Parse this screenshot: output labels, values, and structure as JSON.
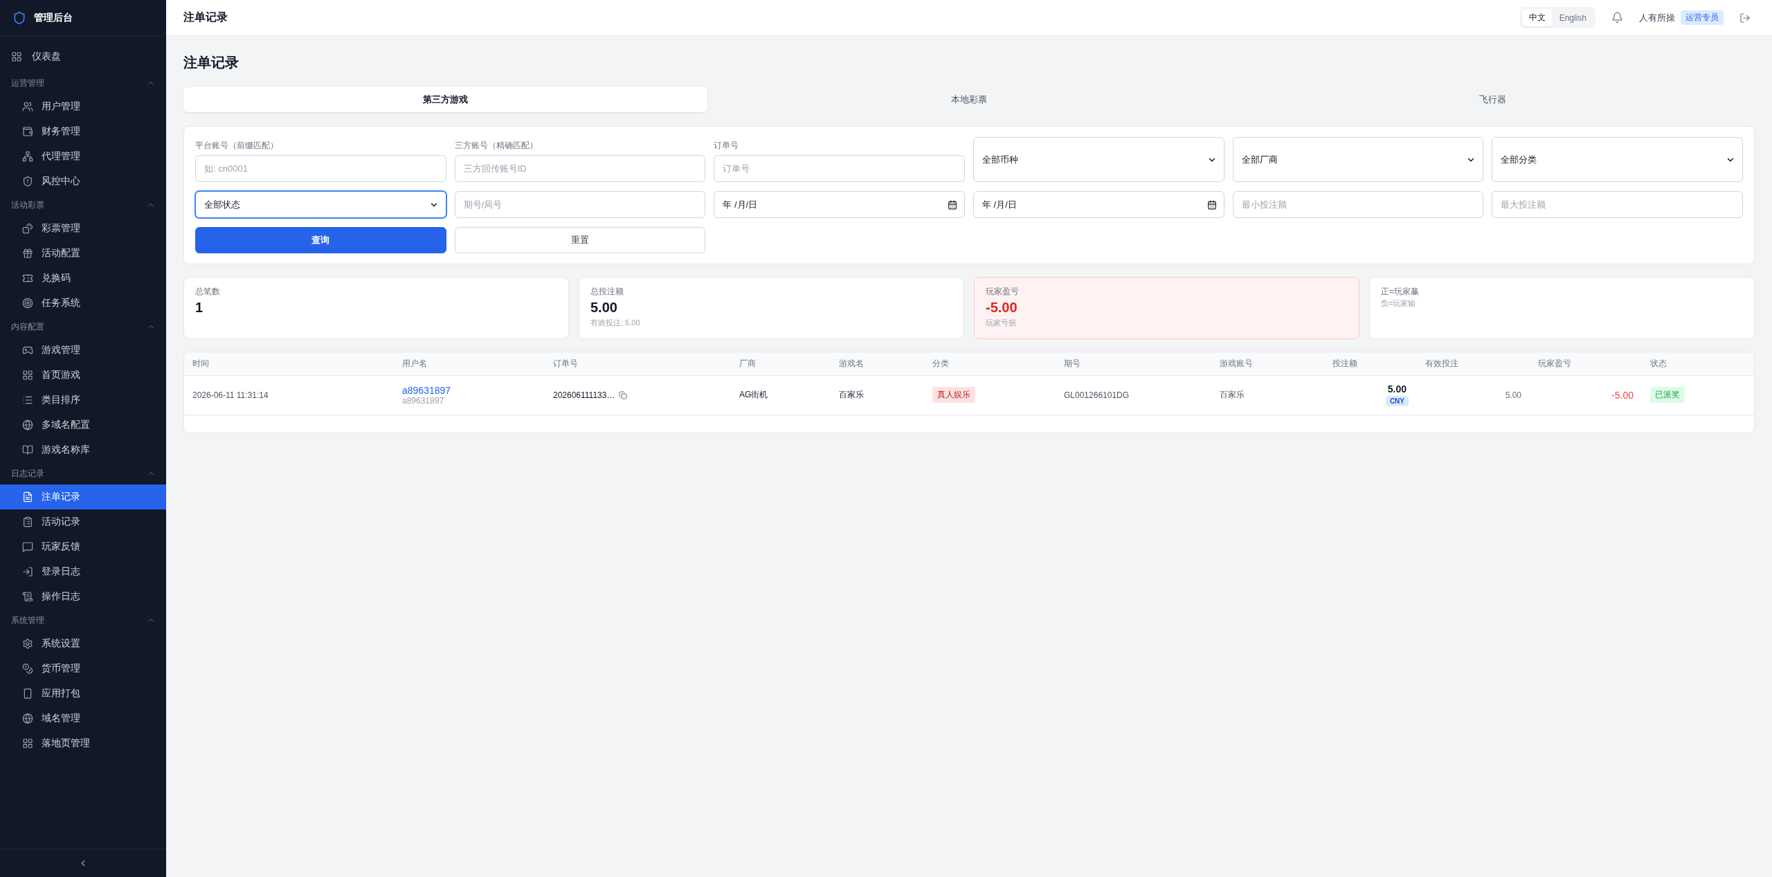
{
  "sidebar": {
    "brand": "管理后台",
    "items": [
      {
        "label": "仪表盘",
        "selected": false
      }
    ],
    "groups": [
      {
        "title": "运营管理",
        "expanded": true,
        "children": [
          {
            "label": "用户管理",
            "selected": false
          },
          {
            "label": "财务管理",
            "selected": false
          },
          {
            "label": "代理管理",
            "selected": false
          },
          {
            "label": "风控中心",
            "selected": false
          }
        ]
      },
      {
        "title": "活动彩票",
        "expanded": true,
        "children": [
          {
            "label": "彩票管理",
            "selected": false
          },
          {
            "label": "活动配置",
            "selected": false
          },
          {
            "label": "兑换码",
            "selected": false
          },
          {
            "label": "任务系统",
            "selected": false
          }
        ]
      },
      {
        "title": "内容配置",
        "expanded": true,
        "children": [
          {
            "label": "游戏管理",
            "selected": false
          },
          {
            "label": "首页游戏",
            "selected": false
          },
          {
            "label": "类目排序",
            "selected": false
          },
          {
            "label": "多域名配置",
            "selected": false
          },
          {
            "label": "游戏名称库",
            "selected": false
          }
        ]
      },
      {
        "title": "日志记录",
        "expanded": true,
        "children": [
          {
            "label": "注单记录",
            "selected": true
          },
          {
            "label": "活动记录",
            "selected": false
          },
          {
            "label": "玩家反馈",
            "selected": false
          },
          {
            "label": "登录日志",
            "selected": false
          },
          {
            "label": "操作日志",
            "selected": false
          }
        ]
      },
      {
        "title": "系统管理",
        "expanded": true,
        "children": [
          {
            "label": "系统设置",
            "selected": false
          },
          {
            "label": "货币管理",
            "selected": false
          },
          {
            "label": "应用打包",
            "selected": false
          },
          {
            "label": "域名管理",
            "selected": false
          },
          {
            "label": "落地页管理",
            "selected": false
          }
        ]
      }
    ]
  },
  "header": {
    "title": "注单记录",
    "languages": [
      {
        "label": "中文",
        "selected": true
      },
      {
        "label": "English",
        "selected": false
      }
    ],
    "user_name": "人有所操",
    "user_role": "运营专员"
  },
  "page_title": "注单记录",
  "tabs": [
    {
      "label": "第三方游戏",
      "selected": true
    },
    {
      "label": "本地彩票",
      "selected": false
    },
    {
      "label": "飞行器",
      "selected": false
    }
  ],
  "filters": {
    "fields": [
      {
        "kind": "text",
        "label": "平台账号（前缀匹配）",
        "placeholder": "如: cn0001",
        "focused": false
      },
      {
        "kind": "text",
        "label": "三方账号（精确匹配）",
        "placeholder": "三方回传账号ID",
        "focused": false
      },
      {
        "kind": "text",
        "label": "订单号",
        "placeholder": "订单号",
        "focused": false
      },
      {
        "kind": "select",
        "value": "全部币种",
        "focused": false
      },
      {
        "kind": "select",
        "value": "全部厂商",
        "focused": false
      },
      {
        "kind": "select",
        "value": "全部分类",
        "focused": false
      },
      {
        "kind": "select",
        "value": "全部状态",
        "focused": true
      },
      {
        "kind": "text",
        "placeholder": "期号/局号",
        "focused": false
      },
      {
        "kind": "date",
        "value": "年 /月/日",
        "focused": false
      },
      {
        "kind": "date",
        "value": "年 /月/日",
        "focused": false
      },
      {
        "kind": "text",
        "placeholder": "最小投注额",
        "focused": false
      },
      {
        "kind": "text",
        "placeholder": "最大投注额",
        "focused": false
      }
    ],
    "buttons": [
      {
        "label": "查询",
        "kind": "primary"
      },
      {
        "label": "重置",
        "kind": "secondary"
      }
    ]
  },
  "stats": [
    {
      "kind": "plain",
      "label": "总笔数",
      "value": "1"
    },
    {
      "kind": "plain",
      "label": "总投注额",
      "value": "5.00",
      "note": "有效投注: 5.00"
    },
    {
      "kind": "loss",
      "label": "玩家盈亏",
      "value": "-5.00",
      "note": "玩家亏损"
    },
    {
      "kind": "legend",
      "lines": [
        "正=玩家赢",
        "负=玩家输"
      ]
    }
  ],
  "table": {
    "columns": [
      "时间",
      "用户名",
      "订单号",
      "厂商",
      "游戏名",
      "分类",
      "期号",
      "游戏账号",
      "投注额",
      "有效投注",
      "玩家盈亏",
      "状态"
    ],
    "rows": [
      {
        "time": "2026-06-11 11:31:14",
        "username": "a89631897",
        "username_sub": "a89631897",
        "order_no": "202606111133…",
        "vendor": "AG街机",
        "game_name": "百家乐",
        "category": "真人娱乐",
        "period": "GL001266101DG",
        "game_account": "百家乐",
        "bet_amount": "5.00",
        "currency": "CNY",
        "valid_bet": "5.00",
        "player_pnl": "-5.00",
        "pnl_negative": true,
        "status": "已派奖"
      }
    ]
  }
}
